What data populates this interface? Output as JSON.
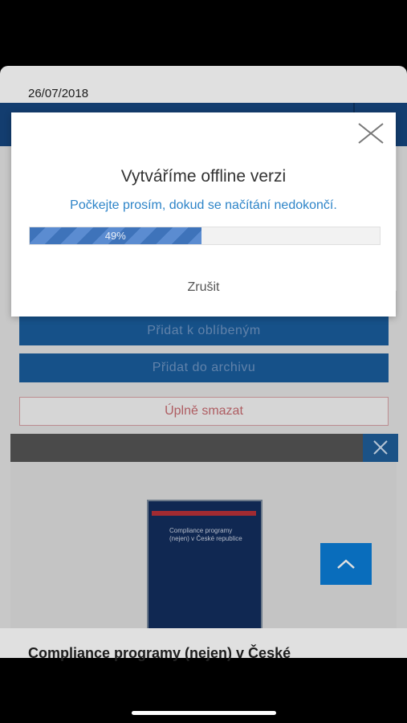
{
  "page": {
    "date": "26/07/2018",
    "actions": {
      "favorites": "Přidat k oblíbeným",
      "archive": "Přidat do archivu",
      "delete": "Úplně smazat"
    },
    "book": {
      "cover_title": "Compliance programy (nejen) v České republice",
      "title": "Compliance programy (nejen) v České"
    }
  },
  "modal": {
    "title": "Vytváříme offline verzi",
    "subtitle": "Počkejte prosím, dokud se načítání nedokončí.",
    "progress_percent": 49,
    "progress_label": "49%",
    "cancel_label": "Zrušit"
  },
  "colors": {
    "header_blue": "#16467f",
    "button_blue": "#1a5d9c",
    "accent_text": "#2d84c8",
    "progress_fill": "#3e73ba",
    "scroll_top_blue": "#0b7dd6",
    "delete_border": "#d6a0a3"
  },
  "icons": {
    "modal_close": "close-icon",
    "panel_close": "close-icon",
    "scroll_top": "chevron-up-icon"
  }
}
